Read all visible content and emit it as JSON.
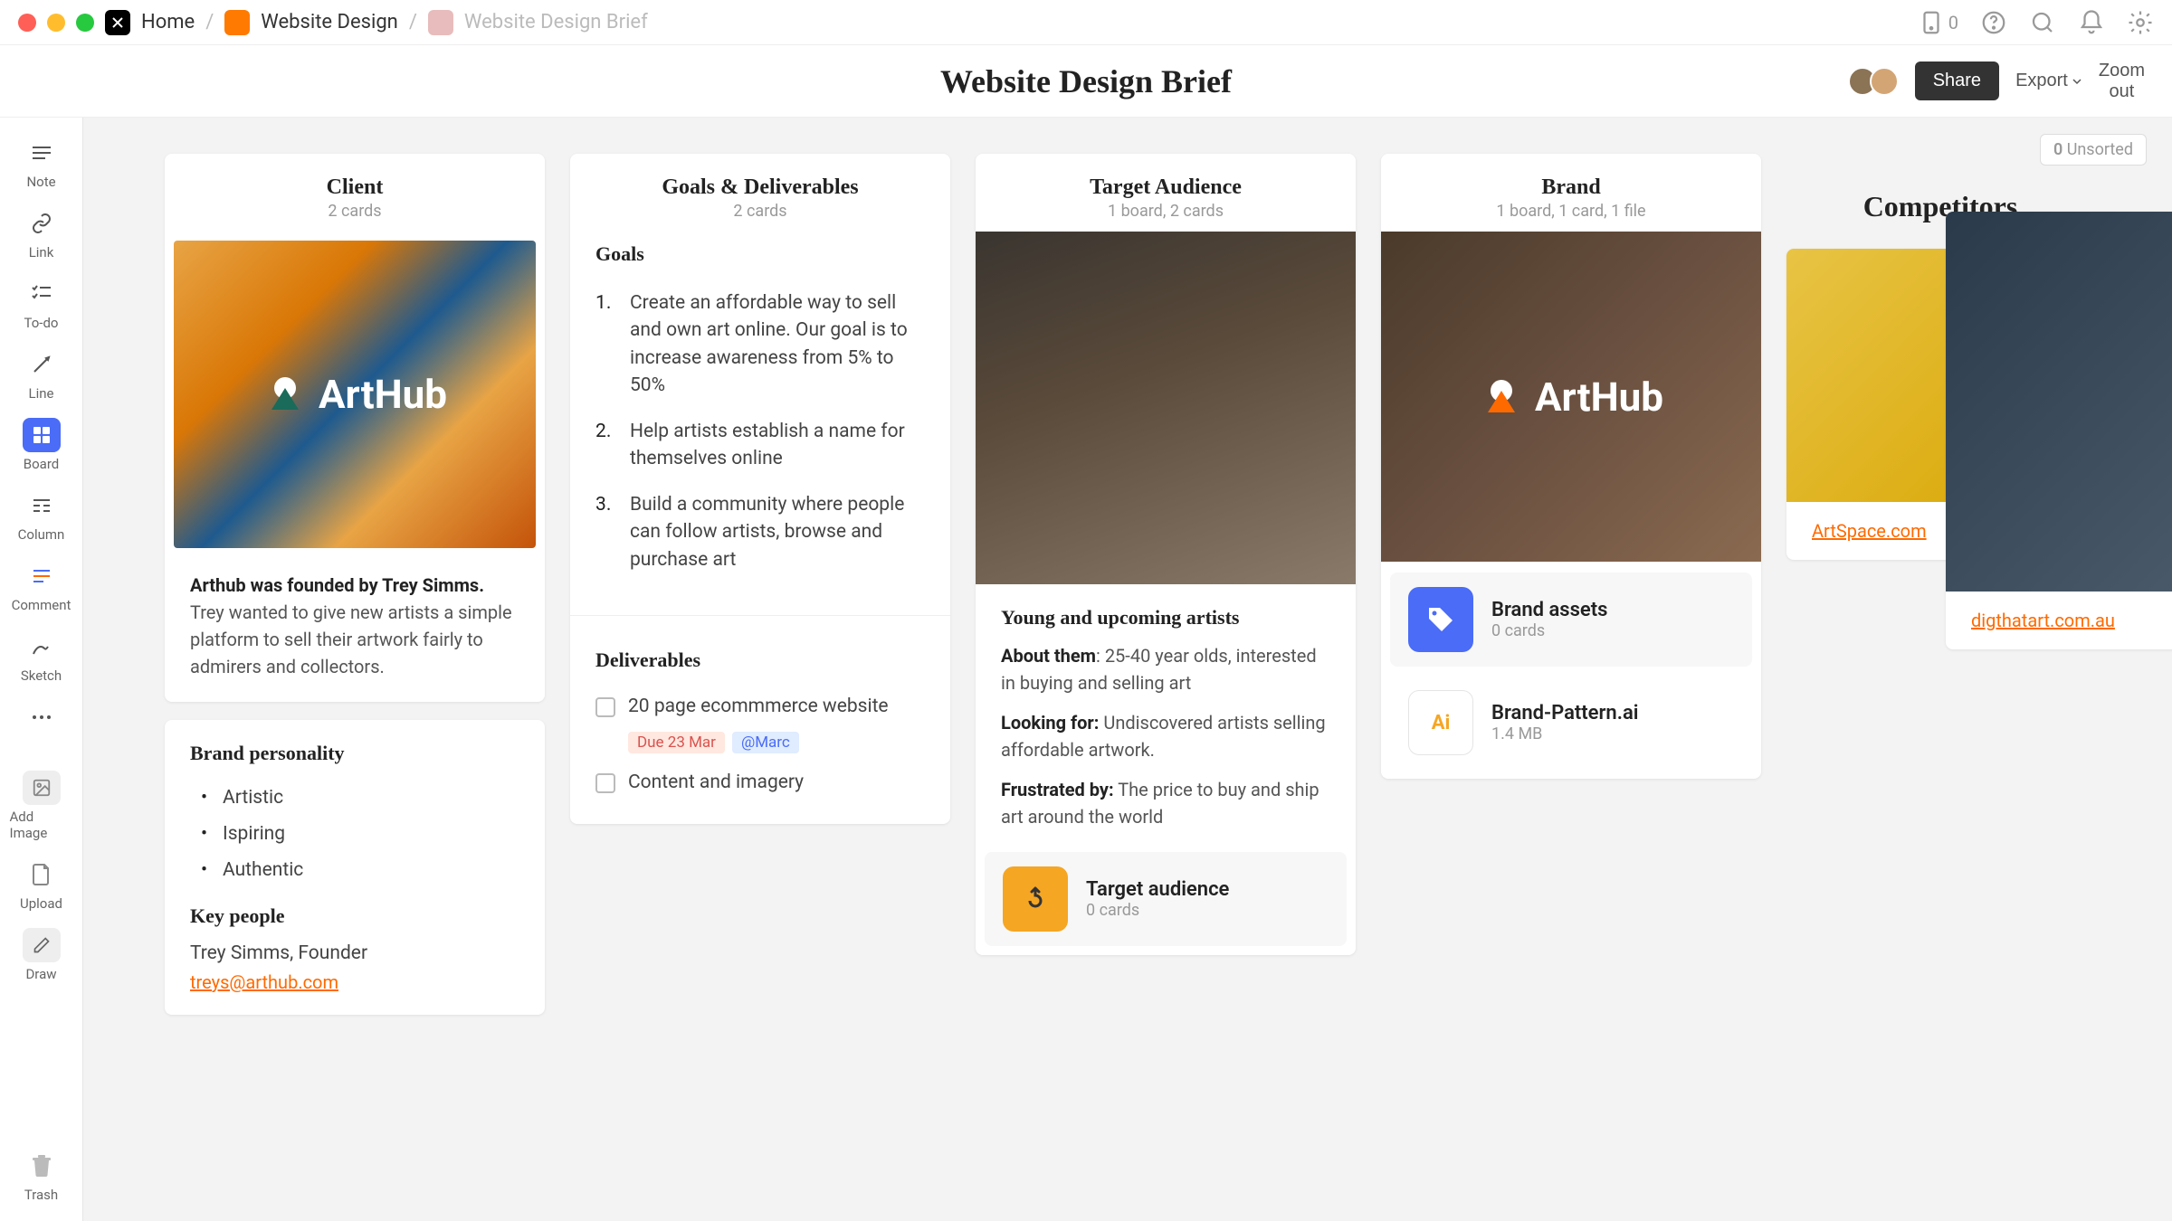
{
  "titlebar": {
    "home": "Home",
    "crumb_parent": "Website Design",
    "crumb_current": "Website Design Brief",
    "inbox_count": "0"
  },
  "header": {
    "title": "Website Design Brief",
    "share": "Share",
    "export": "Export",
    "zoom": "Zoom out"
  },
  "sidebar": {
    "items": [
      {
        "label": "Note"
      },
      {
        "label": "Link"
      },
      {
        "label": "To-do"
      },
      {
        "label": "Line"
      },
      {
        "label": "Board"
      },
      {
        "label": "Column"
      },
      {
        "label": "Comment"
      },
      {
        "label": "Sketch"
      },
      {
        "label": "Add Image"
      },
      {
        "label": "Upload"
      },
      {
        "label": "Draw"
      }
    ],
    "trash": "Trash"
  },
  "unsorted": {
    "count": "0",
    "label": " Unsorted"
  },
  "columns": {
    "client": {
      "title": "Client",
      "sub": "2 cards",
      "logo": "ArtHub",
      "founded_bold": "Arthub was founded by Trey Simms.",
      "founded_rest": " Trey wanted to give new artists a simple platform to sell their artwork fairly to admirers and collectors.",
      "brand_personality_title": "Brand personality",
      "personality": [
        "Artistic",
        "Ispiring",
        "Authentic"
      ],
      "key_people_title": "Key people",
      "key_people": "Trey Simms, Founder",
      "email": "treys@arthub.com"
    },
    "goals": {
      "title": "Goals & Deliverables",
      "sub": "2 cards",
      "goals_heading": "Goals",
      "goals": [
        "Create an affordable way to sell and own art online. Our goal is to increase awareness from 5% to 50%",
        "Help artists establish a name for themselves online",
        "Build a community where people can follow artists, browse and purchase art"
      ],
      "deliverables_heading": "Deliverables",
      "deliverables": [
        {
          "text": "20 page ecommmerce website",
          "due": "Due 23 Mar",
          "mention": "@Marc"
        },
        {
          "text": "Content and imagery"
        }
      ]
    },
    "audience": {
      "title": "Target Audience",
      "sub": "1 board, 2 cards",
      "persona_title": "Young and upcoming artists",
      "about_label": "About them",
      "about_text": ": 25-40 year olds, interested in buying and selling art",
      "looking_label": "Looking for:",
      "looking_text": " Undiscovered artists selling affordable artwork.",
      "frustrated_label": "Frustrated by:",
      "frustrated_text": " The price to buy and ship art around the world",
      "linked_title": "Target audience",
      "linked_sub": "0 cards"
    },
    "brand": {
      "title": "Brand",
      "sub": "1 board, 1 card, 1 file",
      "logo": "ArtHub",
      "assets_title": "Brand assets",
      "assets_sub": "0 cards",
      "file_name": "Brand-Pattern.ai",
      "file_size": "1.4 MB",
      "file_icon_label": "Ai"
    },
    "competitors": {
      "title": "Competitors",
      "link1": "ArtSpace.com",
      "link2": "digthatart.com.au"
    }
  }
}
